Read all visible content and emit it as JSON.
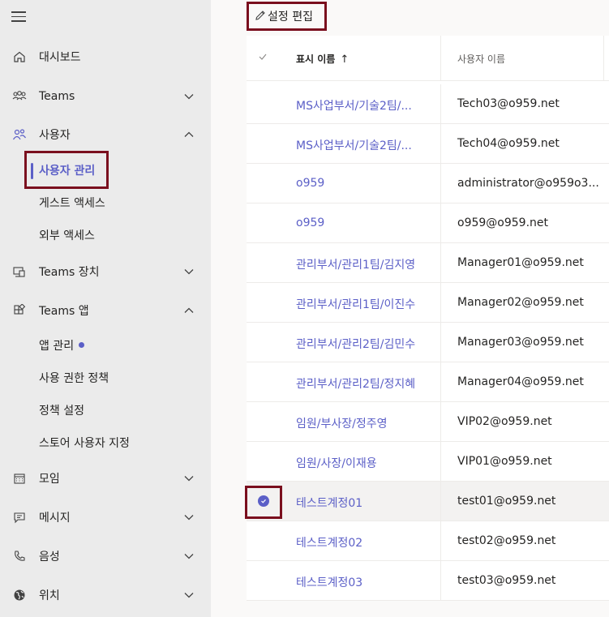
{
  "sidebar": {
    "items": [
      {
        "label": "대시보드",
        "icon": "home-icon"
      },
      {
        "label": "Teams",
        "icon": "teams-icon"
      },
      {
        "label": "사용자",
        "icon": "users-icon"
      },
      {
        "label": "Teams 장치",
        "icon": "devices-icon"
      },
      {
        "label": "Teams 앱",
        "icon": "apps-icon"
      },
      {
        "label": "모임",
        "icon": "calendar-icon"
      },
      {
        "label": "메시지",
        "icon": "message-icon"
      },
      {
        "label": "음성",
        "icon": "phone-icon"
      },
      {
        "label": "위치",
        "icon": "globe-icon"
      }
    ],
    "users_sub": [
      {
        "label": "사용자 관리"
      },
      {
        "label": "게스트 액세스"
      },
      {
        "label": "외부 액세스"
      }
    ],
    "apps_sub": [
      {
        "label": "앱 관리"
      },
      {
        "label": "사용 권한 정책"
      },
      {
        "label": "정책 설정"
      },
      {
        "label": "스토어 사용자 지정"
      }
    ]
  },
  "toolbar": {
    "edit_label": "설정 편집"
  },
  "table": {
    "headers": {
      "name": "표시 이름",
      "sort_arrow": "↑",
      "user": "사용자 이름"
    },
    "rows": [
      {
        "name": "MS사업부서/기술2팀/...",
        "user": "Tech03@o959.net"
      },
      {
        "name": "MS사업부서/기술2팀/...",
        "user": "Tech04@o959.net"
      },
      {
        "name": "o959",
        "user": "administrator@o959o3..."
      },
      {
        "name": "o959",
        "user": "o959@o959.net"
      },
      {
        "name": "관리부서/관리1팀/김지영",
        "user": "Manager01@o959.net"
      },
      {
        "name": "관리부서/관리1팀/이진수",
        "user": "Manager02@o959.net"
      },
      {
        "name": "관리부서/관리2팀/김민수",
        "user": "Manager03@o959.net"
      },
      {
        "name": "관리부서/관리2팀/정지혜",
        "user": "Manager04@o959.net"
      },
      {
        "name": "임원/부사장/정주영",
        "user": "VIP02@o959.net"
      },
      {
        "name": "임원/사장/이재용",
        "user": "VIP01@o959.net"
      },
      {
        "name": "테스트계정01",
        "user": "test01@o959.net"
      },
      {
        "name": "테스트계정02",
        "user": "test02@o959.net"
      },
      {
        "name": "테스트계정03",
        "user": "test03@o959.net"
      }
    ]
  },
  "colors": {
    "accent": "#5b5fc7",
    "highlight": "#7a0f1e",
    "sidebar_bg": "#ebebeb"
  }
}
